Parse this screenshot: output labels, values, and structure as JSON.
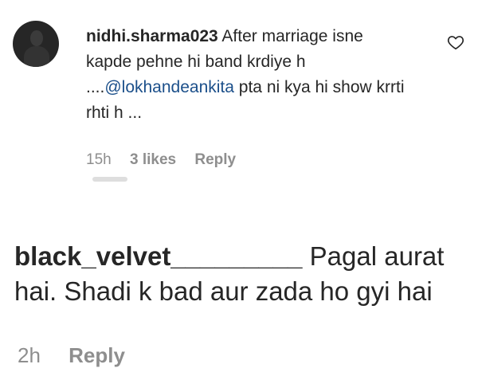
{
  "comments": [
    {
      "username": "nidhi.sharma023",
      "text_before_mention": "After marriage isne kapde pehne hi band krdiye h ....",
      "mention": "@lokhandeankita",
      "text_after_mention": " pta ni kya hi show krrti rhti h ...",
      "time": "15h",
      "likes": "3 likes",
      "reply_label": "Reply",
      "like_icon": "heart-outline-icon"
    },
    {
      "username": "black_velvet_________",
      "text": " Pagal aurat hai. Shadi k bad aur zada ho gyi hai",
      "time": "2h",
      "reply_label": "Reply"
    }
  ],
  "colors": {
    "text": "#262626",
    "meta": "#8e8e8e",
    "mention": "#1b4f8a",
    "background": "#ffffff"
  }
}
